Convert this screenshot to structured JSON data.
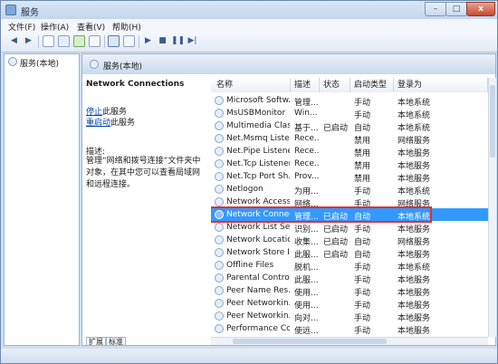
{
  "window": {
    "title": "服务",
    "min": "–",
    "max": "□",
    "close": "x"
  },
  "menu": [
    {
      "label": "文件(F)"
    },
    {
      "label": "操作(A)"
    },
    {
      "label": "查看(V)"
    },
    {
      "label": "帮助(H)"
    }
  ],
  "toolbar": {
    "back": "◀",
    "forward": "▶",
    "play": "▶",
    "stop": "■",
    "pause": "❚❚",
    "restart": "▶|"
  },
  "tree": {
    "root_label": "服务(本地)"
  },
  "content": {
    "header_title": "服务(本地)"
  },
  "detail": {
    "service_name": "Network Connections",
    "stop_link": "停止",
    "stop_suffix": "此服务",
    "restart_link": "重启动",
    "restart_suffix": "此服务",
    "desc_label": "描述:",
    "desc_text": "管理“网络和拨号连接”文件夹中对象，在其中您可以查看局域网和远程连接。"
  },
  "columns": [
    "名称",
    "描述",
    "状态",
    "启动类型",
    "登录为"
  ],
  "rows": [
    {
      "name": "Microsoft Softw...",
      "desc": "管理...",
      "status": "",
      "startup": "手动",
      "logon": "本地系统"
    },
    {
      "name": "MsUSBMonitor",
      "desc": "Win...",
      "status": "",
      "startup": "手动",
      "logon": "本地系统"
    },
    {
      "name": "Multimedia Clas...",
      "desc": "基于...",
      "status": "已启动",
      "startup": "自动",
      "logon": "本地系统"
    },
    {
      "name": "Net.Msmq Liste...",
      "desc": "Rece...",
      "status": "",
      "startup": "禁用",
      "logon": "网络服务"
    },
    {
      "name": "Net.Pipe Listene...",
      "desc": "Rece...",
      "status": "",
      "startup": "禁用",
      "logon": "本地服务"
    },
    {
      "name": "Net.Tcp Listener...",
      "desc": "Rece...",
      "status": "",
      "startup": "禁用",
      "logon": "本地服务"
    },
    {
      "name": "Net.Tcp Port Sh...",
      "desc": "Prov...",
      "status": "",
      "startup": "禁用",
      "logon": "本地服务"
    },
    {
      "name": "Netlogon",
      "desc": "为用...",
      "status": "",
      "startup": "手动",
      "logon": "本地系统"
    },
    {
      "name": "Network Access ...",
      "desc": "网络...",
      "status": "",
      "startup": "手动",
      "logon": "网络服务"
    },
    {
      "name": "Network Connec...",
      "desc": "管理...",
      "status": "已启动",
      "startup": "自动",
      "logon": "本地系统"
    },
    {
      "name": "Network List Ser...",
      "desc": "识别...",
      "status": "已启动",
      "startup": "手动",
      "logon": "本地服务"
    },
    {
      "name": "Network Locatio...",
      "desc": "收集...",
      "status": "已启动",
      "startup": "自动",
      "logon": "网络服务"
    },
    {
      "name": "Network Store I...",
      "desc": "此服...",
      "status": "已启动",
      "startup": "自动",
      "logon": "本地服务"
    },
    {
      "name": "Offline Files",
      "desc": "脱机...",
      "status": "",
      "startup": "手动",
      "logon": "本地系统"
    },
    {
      "name": "Parental Controls",
      "desc": "此服...",
      "status": "",
      "startup": "手动",
      "logon": "本地服务"
    },
    {
      "name": "Peer Name Res...",
      "desc": "使用...",
      "status": "",
      "startup": "手动",
      "logon": "本地服务"
    },
    {
      "name": "Peer Networkin...",
      "desc": "使用...",
      "status": "",
      "startup": "手动",
      "logon": "本地服务"
    },
    {
      "name": "Peer Networkin...",
      "desc": "向对...",
      "status": "",
      "startup": "手动",
      "logon": "本地服务"
    },
    {
      "name": "Performance Co...",
      "desc": "使远...",
      "status": "",
      "startup": "手动",
      "logon": "本地服务"
    }
  ],
  "selected_row": 9,
  "tabs": [
    "扩展",
    "标准"
  ],
  "colors": {
    "selection": "#3399ff",
    "highlight_border": "#e53030",
    "link": "#0645ad"
  }
}
